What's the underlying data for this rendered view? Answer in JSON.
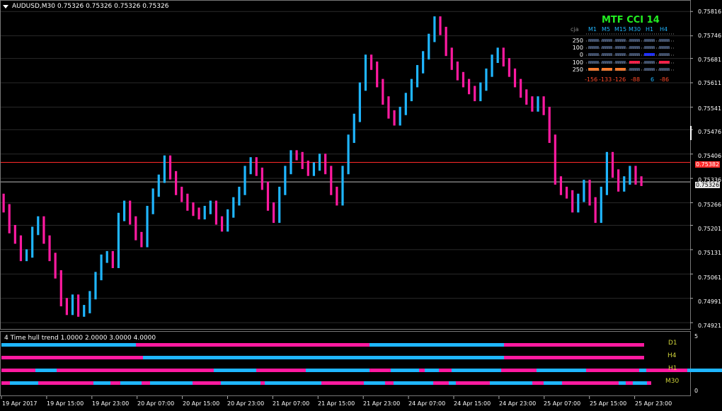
{
  "header": {
    "symbol_label": "AUDUSD,M30",
    "ohlc": "0.75326 0.75326 0.75326 0.75326"
  },
  "price_axis": {
    "labels": [
      "0.75816",
      "0.75746",
      "0.75681",
      "0.75611",
      "0.75541",
      "0.75476",
      "0.75406",
      "0.75336",
      "0.75266",
      "0.75201",
      "0.75131",
      "0.75061",
      "0.74991",
      "0.74921"
    ]
  },
  "price_tags": {
    "red": "0.75382",
    "current": "0.75326"
  },
  "time_axis": {
    "labels": [
      "19 Apr 2017",
      "19 Apr 15:00",
      "19 Apr 23:00",
      "20 Apr 07:00",
      "20 Apr 15:00",
      "20 Apr 23:00",
      "21 Apr 07:00",
      "21 Apr 15:00",
      "21 Apr 23:00",
      "24 Apr 07:00",
      "24 Apr 15:00",
      "24 Apr 23:00",
      "25 Apr 07:00",
      "25 Apr 15:00",
      "25 Apr 23:00"
    ]
  },
  "mtf_cci": {
    "title": "MTF CCI  14",
    "cja_label": "cja",
    "timeframes": [
      "M1",
      "M5",
      "M15",
      "M30",
      "H1",
      "H4"
    ],
    "levels": [
      "250",
      "100",
      "0",
      "100",
      "250"
    ],
    "values": [
      "-156",
      "-133",
      "-126",
      "-88",
      "6",
      "-86"
    ]
  },
  "subwindow": {
    "title": "4 Time hull trend 1.0000 2.0000 3.0000 4.0000",
    "trend_labels": [
      "D1",
      "H4",
      "H1",
      "M30"
    ],
    "scale_labels": [
      "5",
      "0"
    ]
  },
  "colors": {
    "bull": "#1fb6ff",
    "bear": "#ff1aa0",
    "grid": "#2a2a2a",
    "red_line": "#ff2a2a",
    "current_line": "#bbbbbb",
    "cci_bar": "#3a4a66",
    "cci_blue": "#1a2cff",
    "cci_red": "#ff1a44",
    "cci_orange": "#ff7a2a"
  },
  "chart_data": {
    "type": "candlestick",
    "bar_period": "M30",
    "ylim": [
      0.74905,
      0.75845
    ],
    "close_series": [
      0.7525,
      0.7519,
      0.7516,
      0.7511,
      0.7512,
      0.75185,
      0.75215,
      0.7516,
      0.7511,
      0.7506,
      0.7498,
      0.74955,
      0.7499,
      0.7495,
      0.7496,
      0.75,
      0.75055,
      0.75105,
      0.75115,
      0.7509,
      0.75225,
      0.7526,
      0.75215,
      0.7517,
      0.7515,
      0.75245,
      0.75295,
      0.75335,
      0.7539,
      0.75345,
      0.753,
      0.7528,
      0.75255,
      0.7524,
      0.7523,
      0.75245,
      0.7526,
      0.75215,
      0.75195,
      0.75235,
      0.7527,
      0.753,
      0.7536,
      0.75385,
      0.75355,
      0.75315,
      0.75255,
      0.7522,
      0.753,
      0.7536,
      0.75405,
      0.754,
      0.75375,
      0.75355,
      0.7537,
      0.75395,
      0.7536,
      0.753,
      0.7527,
      0.7536,
      0.7545,
      0.7551,
      0.756,
      0.7568,
      0.7566,
      0.7561,
      0.7556,
      0.7552,
      0.755,
      0.7553,
      0.7557,
      0.7561,
      0.7565,
      0.7569,
      0.7574,
      0.7579,
      0.7576,
      0.757,
      0.7566,
      0.7563,
      0.7561,
      0.7559,
      0.7557,
      0.756,
      0.7564,
      0.7568,
      0.757,
      0.7567,
      0.7564,
      0.7561,
      0.7558,
      0.7556,
      0.7554,
      0.7556,
      0.7553,
      0.7545,
      0.7533,
      0.753,
      0.7529,
      0.7525,
      0.7528,
      0.7532,
      0.7527,
      0.7522,
      0.753,
      0.754,
      0.7535,
      0.7531,
      0.7533,
      0.7536,
      0.7533,
      0.75326
    ]
  }
}
